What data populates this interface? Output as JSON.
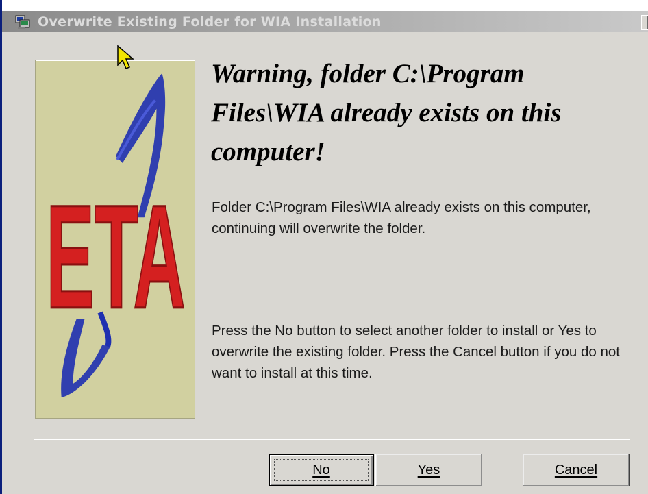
{
  "window": {
    "title": "Overwrite Existing Folder for WIA Installation",
    "title_icon": "setup-computer-icon"
  },
  "logo": {
    "text": "ETA",
    "colors": {
      "background": "#d1d0a0",
      "letters": "#d42020",
      "swoosh": "#1e2fb0"
    }
  },
  "content": {
    "heading": "Warning, folder C:\\Program Files\\WIA already exists on this computer!",
    "message1": "Folder C:\\Program Files\\WIA already exists on this computer, continuing will overwrite the folder.",
    "message2": "Press the No button to select another folder to install or Yes to overwrite the existing folder. Press the Cancel button if you do not want to install at this time."
  },
  "buttons": {
    "no": {
      "label": "No",
      "default": true
    },
    "yes": {
      "label": "Yes"
    },
    "cancel": {
      "label": "Cancel"
    }
  },
  "cursor": "arrow-cursor-icon"
}
